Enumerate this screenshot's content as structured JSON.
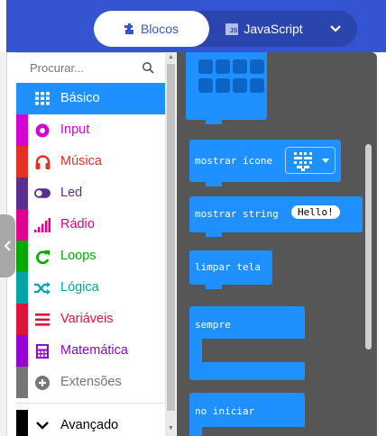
{
  "header": {
    "tabs": [
      {
        "label": "Blocos",
        "icon": "puzzle-piece-icon",
        "active": true
      },
      {
        "label": "JavaScript",
        "icon": "javascript-file-icon",
        "active": false
      }
    ],
    "js_badge": "JS",
    "more_icon": "chevron-down-icon",
    "colors": {
      "header": "#3454d1",
      "tab_group": "#2a45ad"
    }
  },
  "search": {
    "placeholder": "Procurar..."
  },
  "categories": [
    {
      "label": "Básico",
      "icon": "grid-icon",
      "color": "#1e90ff",
      "selected": true
    },
    {
      "label": "Input",
      "icon": "circle-dot-icon",
      "color": "#d400d4"
    },
    {
      "label": "Música",
      "icon": "headphones-icon",
      "color": "#e63022"
    },
    {
      "label": "Led",
      "icon": "toggle-icon",
      "color": "#5c2d91"
    },
    {
      "label": "Rádio",
      "icon": "signal-bars-icon",
      "color": "#e3008c"
    },
    {
      "label": "Loops",
      "icon": "loop-arrow-icon",
      "color": "#00aa00"
    },
    {
      "label": "Lógica",
      "icon": "shuffle-icon",
      "color": "#00a4a6"
    },
    {
      "label": "Variáveis",
      "icon": "list-lines-icon",
      "color": "#dc143c"
    },
    {
      "label": "Matemática",
      "icon": "calculator-icon",
      "color": "#9400d3"
    },
    {
      "label": "Extensões",
      "icon": "plus-circle-icon",
      "color": "#757575"
    },
    {
      "label": "Avançado",
      "icon": "chevron-down-icon",
      "color": "#000000"
    }
  ],
  "blocks": {
    "show_icon": "mostrar ícone",
    "show_string": "mostrar string",
    "string_value": "Hello!",
    "clear_screen": "limpar tela",
    "forever": "sempre",
    "on_start": "no iniciar"
  },
  "collapse_icon": "chevron-left-icon"
}
